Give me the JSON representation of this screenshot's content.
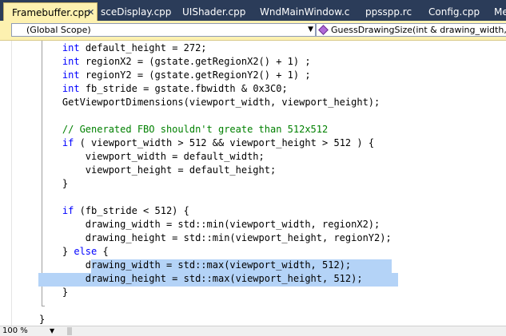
{
  "tabs": [
    {
      "label": "Framebuffer.cpp",
      "active": true,
      "close_glyph": "✕"
    },
    {
      "label": "sceDisplay.cpp",
      "active": false
    },
    {
      "label": "UIShader.cpp",
      "active": false
    },
    {
      "label": "WndMainWindow.cpp",
      "active": false
    },
    {
      "label": "ppsspp.rc",
      "active": false
    },
    {
      "label": "Config.cpp",
      "active": false
    },
    {
      "label": "Me",
      "active": false
    }
  ],
  "scope_selector": {
    "value": "(Global Scope)",
    "icon": "chevron-down-icon"
  },
  "member_selector": {
    "value": "GuessDrawingSize(int & drawing_width, int &",
    "icon": "method-icon"
  },
  "code_lines": [
    {
      "text": "    int default_height = 272;"
    },
    {
      "text": "    int regionX2 = (gstate.getRegionX2() + 1) ;"
    },
    {
      "text": "    int regionY2 = (gstate.getRegionY2() + 1) ;"
    },
    {
      "text": "    int fb_stride = gstate.fbwidth & 0x3C0;"
    },
    {
      "text": "    GetViewportDimensions(viewport_width, viewport_height);"
    },
    {
      "text": ""
    },
    {
      "text": "    // Generated FBO shouldn't greate than 512x512"
    },
    {
      "text": "    if ( viewport_width > 512 && viewport_height > 512 ) {"
    },
    {
      "text": "        viewport_width = default_width;"
    },
    {
      "text": "        viewport_height = default_height;"
    },
    {
      "text": "    }"
    },
    {
      "text": ""
    },
    {
      "text": "    if (fb_stride < 512) {"
    },
    {
      "text": "        drawing_width = std::min(viewport_width, regionX2);"
    },
    {
      "text": "        drawing_height = std::min(viewport_height, regionY2);"
    },
    {
      "text": "    } else {"
    },
    {
      "text": "        drawing_width = std::max(viewport_width, 512);"
    },
    {
      "text": "        drawing_height = std::max(viewport_height, 512);"
    },
    {
      "text": "    }"
    },
    {
      "text": ""
    },
    {
      "text": "}"
    }
  ],
  "status": {
    "zoom": "100 %"
  },
  "colors": {
    "keyword": "#0000ff",
    "comment": "#008000",
    "selection": "#b4d3f7",
    "tab_active": "#fdf1b0",
    "tab_strip": "#2b3c59"
  }
}
